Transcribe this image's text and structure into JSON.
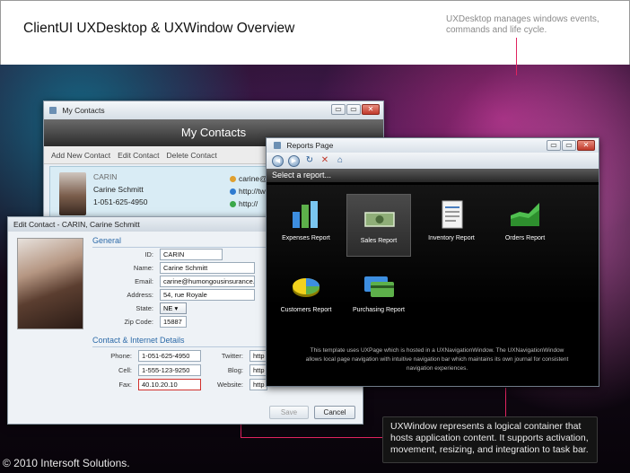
{
  "slide": {
    "title": "ClientUI UXDesktop & UXWindow Overview",
    "desktop_note": "UXDesktop manages windows events, commands and life cycle.",
    "window_note": "UXWindow represents a logical container that hosts application content. It supports activation, movement, resizing, and integration to task bar.",
    "copyright": "© 2010 Intersoft Solutions.",
    "accent_color": "#e0235f"
  },
  "contacts_window": {
    "title": "My Contacts",
    "header": "My Contacts",
    "toolbar": [
      "Add New Contact",
      "Edit Contact",
      "Delete Contact"
    ],
    "card": {
      "id": "CARIN",
      "name": "Carine Schmitt",
      "phone": "1-051-625-4950",
      "email_partial": "carine@h",
      "twitter_partial": "http://tw",
      "web_partial": "http://"
    },
    "buttons": {
      "min": "▭",
      "max": "▭",
      "close": "✕"
    }
  },
  "edit_window": {
    "title": "Edit Contact - CARIN, Carine Schmitt",
    "section_general": "General",
    "section_contact": "Contact & Internet Details",
    "fields": {
      "id_label": "ID:",
      "id": "CARIN",
      "name_label": "Name:",
      "name": "Carine Schmitt",
      "email_label": "Email:",
      "email": "carine@humongousinsurance.c",
      "address_label": "Address:",
      "address": "54, rue Royale",
      "state_label": "State:",
      "state": "NE",
      "zip_label": "Zip Code:",
      "zip": "15887",
      "phone_label": "Phone:",
      "phone": "1-051-625-4950",
      "cell_label": "Cell:",
      "cell": "1-555-123-9250",
      "fax_label": "Fax:",
      "fax": "40.10.20.10",
      "twitter_label": "Twitter:",
      "twitter": "http",
      "blog_label": "Blog:",
      "blog": "http",
      "website_label": "Website:",
      "website": "http"
    },
    "save_label": "Save",
    "cancel_label": "Cancel",
    "error_color": "#d0312d"
  },
  "reports_window": {
    "title": "Reports Page",
    "heading": "Select a report...",
    "reports": [
      {
        "label": "Expenses Report",
        "icon": "bar-chart-icon"
      },
      {
        "label": "Sales Report",
        "icon": "money-icon",
        "selected": true
      },
      {
        "label": "Inventory Report",
        "icon": "document-icon"
      },
      {
        "label": "Orders Report",
        "icon": "area-chart-icon"
      },
      {
        "label": "Customers Report",
        "icon": "pie-chart-icon"
      },
      {
        "label": "Purchasing Report",
        "icon": "credit-card-icon"
      }
    ],
    "footer": "This template uses UXPage which is hosted in a UXNavigationWindow. The UXNavigationWindow allows local page navigation with intuitive navigation bar which maintains its own journal for consistent navigation experiences."
  }
}
